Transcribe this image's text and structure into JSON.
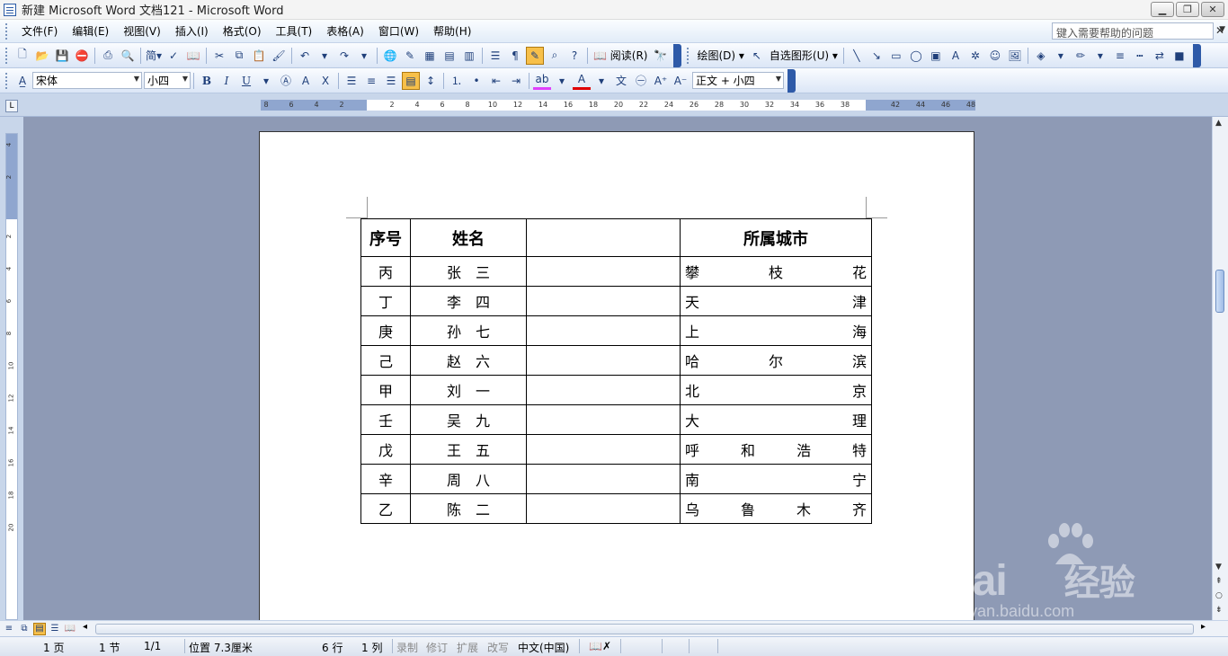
{
  "window": {
    "title": "新建 Microsoft Word 文档121 - Microsoft Word"
  },
  "menubar": {
    "items": [
      "文件(F)",
      "编辑(E)",
      "视图(V)",
      "插入(I)",
      "格式(O)",
      "工具(T)",
      "表格(A)",
      "窗口(W)",
      "帮助(H)"
    ],
    "help_placeholder": "键入需要帮助的问题"
  },
  "toolbar": {
    "reading_label": "阅读(R)",
    "drawing_label": "绘图(D)",
    "autoshapes_label": "自选图形(U)",
    "simplified_label": "简",
    "font_name": "宋体",
    "font_size": "小四",
    "style_name": "正文 + 小四",
    "highlight_color": "#e040fb",
    "font_color": "#e00000"
  },
  "ruler": {
    "h_labels": [
      "8",
      "6",
      "4",
      "2",
      "2",
      "4",
      "6",
      "8",
      "10",
      "12",
      "14",
      "16",
      "18",
      "20",
      "22",
      "24",
      "26",
      "28",
      "30",
      "32",
      "34",
      "36",
      "38",
      "42",
      "44",
      "46",
      "48"
    ],
    "v_labels": [
      "4",
      "2",
      "2",
      "4",
      "6",
      "8",
      "10",
      "12",
      "14",
      "16",
      "18",
      "20"
    ]
  },
  "table": {
    "headers": [
      "序号",
      "姓名",
      "",
      "所属城市"
    ],
    "rows": [
      {
        "seq": "丙",
        "name": [
          "张",
          "三"
        ],
        "city": [
          "攀",
          "枝",
          "花"
        ]
      },
      {
        "seq": "丁",
        "name": [
          "李",
          "四"
        ],
        "city": [
          "天",
          "津"
        ]
      },
      {
        "seq": "庚",
        "name": [
          "孙",
          "七"
        ],
        "city": [
          "上",
          "海"
        ]
      },
      {
        "seq": "己",
        "name": [
          "赵",
          "六"
        ],
        "city": [
          "哈",
          "尔",
          "滨"
        ]
      },
      {
        "seq": "甲",
        "name": [
          "刘",
          "一"
        ],
        "city": [
          "北",
          "京"
        ]
      },
      {
        "seq": "壬",
        "name": [
          "吴",
          "九"
        ],
        "city": [
          "大",
          "理"
        ]
      },
      {
        "seq": "戊",
        "name": [
          "王",
          "五"
        ],
        "city": [
          "呼",
          "和",
          "浩",
          "特"
        ]
      },
      {
        "seq": "辛",
        "name": [
          "周",
          "八"
        ],
        "city": [
          "南",
          "宁"
        ]
      },
      {
        "seq": "乙",
        "name": [
          "陈",
          "二"
        ],
        "city": [
          "乌",
          "鲁",
          "木",
          "齐"
        ]
      }
    ]
  },
  "statusbar": {
    "page": "1 页",
    "section": "1 节",
    "page_of": "1/1",
    "position": "位置 7.3厘米",
    "line": "6 行",
    "column": "1 列",
    "rec": "录制",
    "trk": "修订",
    "ext": "扩展",
    "ovr": "改写",
    "language": "中文(中国)"
  },
  "watermark": {
    "brand": "Bai",
    "brand_suffix": "经验",
    "url": "jingyan.baidu.com"
  }
}
